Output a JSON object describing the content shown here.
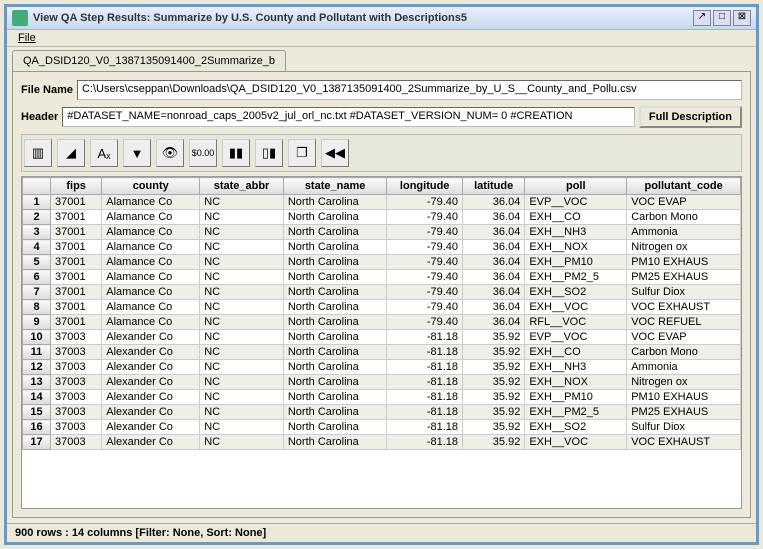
{
  "window": {
    "title": "View QA Step Results: Summarize by U.S. County and Pollutant with Descriptions5"
  },
  "menu": {
    "file": "File"
  },
  "tab": {
    "label": "QA_DSID120_V0_1387135091400_2Summarize_b"
  },
  "fields": {
    "filename_label": "File Name",
    "filename_value": "C:\\Users\\cseppan\\Downloads\\QA_DSID120_V0_1387135091400_2Summarize_by_U_S__County_and_Pollu.csv",
    "header_label": "Header",
    "header_value": "#DATASET_NAME=nonroad_caps_2005v2_jul_orl_nc.txt #DATASET_VERSION_NUM= 0 #CREATION",
    "full_desc_btn": "Full Description"
  },
  "toolbar": {
    "icons": [
      "select-rows-icon",
      "sort-icon",
      "format-icon",
      "filter-icon",
      "view-icon",
      "currency-icon",
      "chart-bar-icon",
      "chart-stats-icon",
      "copy-icon",
      "reset-icon"
    ]
  },
  "table": {
    "columns": [
      "fips",
      "county",
      "state_abbr",
      "state_name",
      "longitude",
      "latitude",
      "poll",
      "pollutant_code"
    ],
    "rows": [
      {
        "n": 1,
        "fips": "37001",
        "county": "Alamance Co",
        "state_abbr": "NC",
        "state_name": "North Carolina",
        "longitude": "-79.40",
        "latitude": "36.04",
        "poll": "EVP__VOC",
        "pollutant_code": "VOC EVAP"
      },
      {
        "n": 2,
        "fips": "37001",
        "county": "Alamance Co",
        "state_abbr": "NC",
        "state_name": "North Carolina",
        "longitude": "-79.40",
        "latitude": "36.04",
        "poll": "EXH__CO",
        "pollutant_code": "Carbon Mono"
      },
      {
        "n": 3,
        "fips": "37001",
        "county": "Alamance Co",
        "state_abbr": "NC",
        "state_name": "North Carolina",
        "longitude": "-79.40",
        "latitude": "36.04",
        "poll": "EXH__NH3",
        "pollutant_code": "Ammonia"
      },
      {
        "n": 4,
        "fips": "37001",
        "county": "Alamance Co",
        "state_abbr": "NC",
        "state_name": "North Carolina",
        "longitude": "-79.40",
        "latitude": "36.04",
        "poll": "EXH__NOX",
        "pollutant_code": "Nitrogen ox"
      },
      {
        "n": 5,
        "fips": "37001",
        "county": "Alamance Co",
        "state_abbr": "NC",
        "state_name": "North Carolina",
        "longitude": "-79.40",
        "latitude": "36.04",
        "poll": "EXH__PM10",
        "pollutant_code": "PM10 EXHAUS"
      },
      {
        "n": 6,
        "fips": "37001",
        "county": "Alamance Co",
        "state_abbr": "NC",
        "state_name": "North Carolina",
        "longitude": "-79.40",
        "latitude": "36.04",
        "poll": "EXH__PM2_5",
        "pollutant_code": "PM25 EXHAUS"
      },
      {
        "n": 7,
        "fips": "37001",
        "county": "Alamance Co",
        "state_abbr": "NC",
        "state_name": "North Carolina",
        "longitude": "-79.40",
        "latitude": "36.04",
        "poll": "EXH__SO2",
        "pollutant_code": "Sulfur Diox"
      },
      {
        "n": 8,
        "fips": "37001",
        "county": "Alamance Co",
        "state_abbr": "NC",
        "state_name": "North Carolina",
        "longitude": "-79.40",
        "latitude": "36.04",
        "poll": "EXH__VOC",
        "pollutant_code": "VOC EXHAUST"
      },
      {
        "n": 9,
        "fips": "37001",
        "county": "Alamance Co",
        "state_abbr": "NC",
        "state_name": "North Carolina",
        "longitude": "-79.40",
        "latitude": "36.04",
        "poll": "RFL__VOC",
        "pollutant_code": "VOC REFUEL"
      },
      {
        "n": 10,
        "fips": "37003",
        "county": "Alexander Co",
        "state_abbr": "NC",
        "state_name": "North Carolina",
        "longitude": "-81.18",
        "latitude": "35.92",
        "poll": "EVP__VOC",
        "pollutant_code": "VOC EVAP"
      },
      {
        "n": 11,
        "fips": "37003",
        "county": "Alexander Co",
        "state_abbr": "NC",
        "state_name": "North Carolina",
        "longitude": "-81.18",
        "latitude": "35.92",
        "poll": "EXH__CO",
        "pollutant_code": "Carbon Mono"
      },
      {
        "n": 12,
        "fips": "37003",
        "county": "Alexander Co",
        "state_abbr": "NC",
        "state_name": "North Carolina",
        "longitude": "-81.18",
        "latitude": "35.92",
        "poll": "EXH__NH3",
        "pollutant_code": "Ammonia"
      },
      {
        "n": 13,
        "fips": "37003",
        "county": "Alexander Co",
        "state_abbr": "NC",
        "state_name": "North Carolina",
        "longitude": "-81.18",
        "latitude": "35.92",
        "poll": "EXH__NOX",
        "pollutant_code": "Nitrogen ox"
      },
      {
        "n": 14,
        "fips": "37003",
        "county": "Alexander Co",
        "state_abbr": "NC",
        "state_name": "North Carolina",
        "longitude": "-81.18",
        "latitude": "35.92",
        "poll": "EXH__PM10",
        "pollutant_code": "PM10 EXHAUS"
      },
      {
        "n": 15,
        "fips": "37003",
        "county": "Alexander Co",
        "state_abbr": "NC",
        "state_name": "North Carolina",
        "longitude": "-81.18",
        "latitude": "35.92",
        "poll": "EXH__PM2_5",
        "pollutant_code": "PM25 EXHAUS"
      },
      {
        "n": 16,
        "fips": "37003",
        "county": "Alexander Co",
        "state_abbr": "NC",
        "state_name": "North Carolina",
        "longitude": "-81.18",
        "latitude": "35.92",
        "poll": "EXH__SO2",
        "pollutant_code": "Sulfur Diox"
      },
      {
        "n": 17,
        "fips": "37003",
        "county": "Alexander Co",
        "state_abbr": "NC",
        "state_name": "North Carolina",
        "longitude": "-81.18",
        "latitude": "35.92",
        "poll": "EXH__VOC",
        "pollutant_code": "VOC EXHAUST"
      }
    ]
  },
  "status": {
    "text": "900 rows : 14 columns [Filter: None, Sort: None]"
  }
}
